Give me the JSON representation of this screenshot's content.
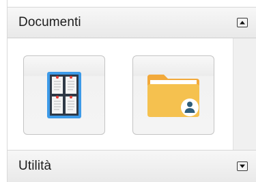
{
  "sections": {
    "documents": {
      "title": "Documenti",
      "toggle_icon": "collapse-up-icon"
    },
    "utilities": {
      "title": "Utilità",
      "toggle_icon": "expand-down-icon"
    }
  },
  "tiles": [
    {
      "name": "board-grid-tile",
      "icon": "document-board-icon"
    },
    {
      "name": "shared-folder-tile",
      "icon": "user-folder-icon"
    }
  ],
  "colors": {
    "board_frame": "#3d9ae8",
    "board_bg": "#2f3946",
    "folder": "#f5c14f",
    "folder_tab": "#f2a93b",
    "user_badge": "#2e5d7a"
  }
}
